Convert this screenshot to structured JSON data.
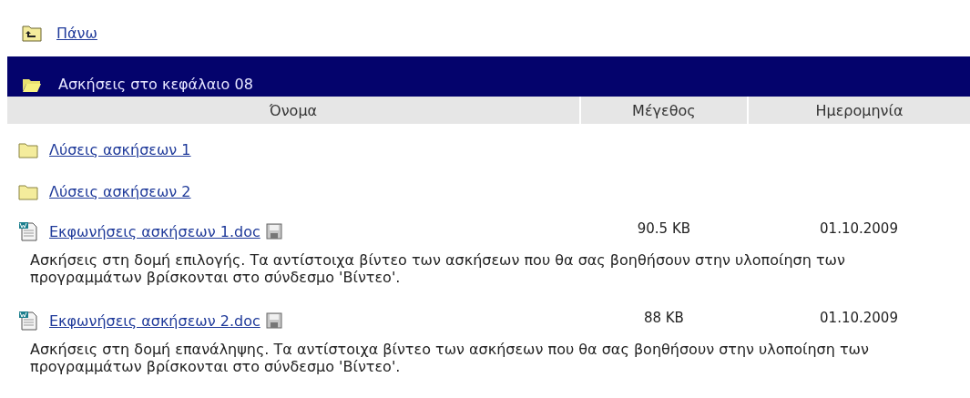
{
  "up_link": {
    "label": "Πάνω"
  },
  "folder_title": "Ασκήσεις στο κεφάλαιο 08",
  "table": {
    "columns": [
      "Όνομα",
      "Μέγεθος",
      "Ημερομηνία"
    ],
    "rows": [
      {
        "kind": "folder",
        "name": "Λύσεις ασκήσεων 1"
      },
      {
        "kind": "folder",
        "name": "Λύσεις ασκήσεων 2"
      },
      {
        "kind": "document",
        "name": "Εκφωνήσεις ασκήσεων 1.doc",
        "size": "90.5 KB",
        "date": "01.10.2009",
        "description": "Ασκήσεις στη δομή επιλογής. Τα αντίστοιχα βίντεο των ασκήσεων που θα σας βοηθήσουν στην υλοποίηση των προγραμμάτων βρίσκονται στο σύνδεσμο 'Βίντεο'."
      },
      {
        "kind": "document",
        "name": "Εκφωνήσεις ασκήσεων 2.doc",
        "size": "88 KB",
        "date": "01.10.2009",
        "description": "Ασκήσεις στη δομή επανάληψης. Τα αντίστοιχα βίντεο των ασκήσεων που θα σας βοηθήσουν στην υλοποίηση των προγραμμάτων βρίσκονται στο σύνδεσμο 'Βίντεο'."
      }
    ]
  }
}
